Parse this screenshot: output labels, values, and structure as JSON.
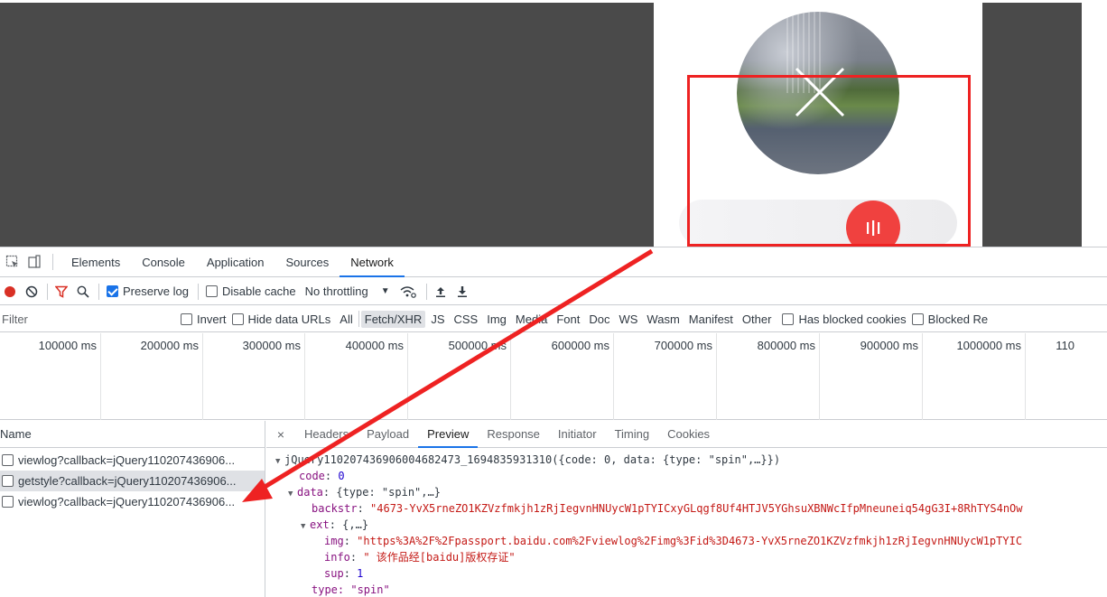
{
  "devtools": {
    "tabs": [
      "Elements",
      "Console",
      "Application",
      "Sources",
      "Network"
    ],
    "active_tab": "Network",
    "toolbar": {
      "preserve_log": "Preserve log",
      "disable_cache": "Disable cache",
      "throttling": "No throttling"
    },
    "filter": {
      "placeholder": "Filter",
      "invert": "Invert",
      "hide_data_urls": "Hide data URLs",
      "types": [
        "All",
        "Fetch/XHR",
        "JS",
        "CSS",
        "Img",
        "Media",
        "Font",
        "Doc",
        "WS",
        "Wasm",
        "Manifest",
        "Other"
      ],
      "active_type": "Fetch/XHR",
      "has_blocked_cookies": "Has blocked cookies",
      "blocked_requests": "Blocked Re"
    },
    "timeline": {
      "ticks": [
        "100000 ms",
        "200000 ms",
        "300000 ms",
        "400000 ms",
        "500000 ms",
        "600000 ms",
        "700000 ms",
        "800000 ms",
        "900000 ms",
        "1000000 ms",
        "110"
      ]
    },
    "requests": {
      "header": "Name",
      "items": [
        "viewlog?callback=jQuery110207436906...",
        "getstyle?callback=jQuery110207436906...",
        "viewlog?callback=jQuery110207436906..."
      ]
    },
    "detail": {
      "close": "×",
      "tabs": [
        "Headers",
        "Payload",
        "Preview",
        "Response",
        "Initiator",
        "Timing",
        "Cookies"
      ],
      "active_tab": "Preview",
      "preview": {
        "line1": "jQuery110207436906004682473_1694835931310({code: 0, data: {type: \"spin\",…}})",
        "code_key": "code",
        "code_val": "0",
        "data_key": "data",
        "data_val": "{type: \"spin\",…}",
        "backstr_key": "backstr",
        "backstr_val": "\"4673-YvX5rneZO1KZVzfmkjh1zRjIegvnHNUycW1pTYICxyGLqgf8Uf4HTJV5YGhsuXBNWcIfpMneuneiq54gG3I+8RhTYS4nOw",
        "ext_key": "ext",
        "ext_val": "{,…}",
        "img_key": "img",
        "img_val": "\"https%3A%2F%2Fpassport.baidu.com%2Fviewlog%2Fimg%3Fid%3D4673-YvX5rneZO1KZVzfmkjh1zRjIegvnHNUycW1pTYIC",
        "info_key": "info",
        "info_val": "\" 该作品经[baidu]版权存证\"",
        "sup_key": "sup",
        "sup_val": "1",
        "type_partial": "type: \"spin\""
      }
    }
  },
  "colors": {
    "annotation_red": "#ee2222",
    "slider_red": "#f0413f",
    "accent_blue": "#1a73e8"
  }
}
